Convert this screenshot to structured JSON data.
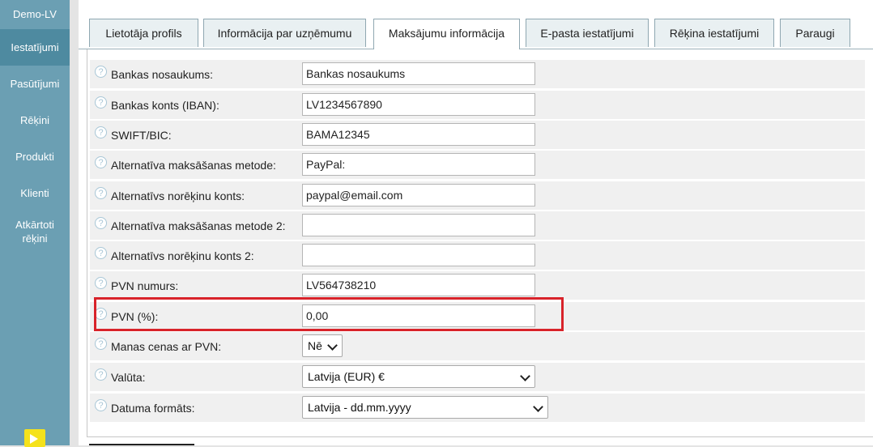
{
  "sidebar": {
    "brand": "Demo-LV",
    "items": [
      {
        "label": "Iestatījumi"
      },
      {
        "label": "Pasūtījumi"
      },
      {
        "label": "Rēķini"
      },
      {
        "label": "Produkti"
      },
      {
        "label": "Klienti"
      },
      {
        "label_line1": "Atkārtoti",
        "label_line2": "rēķini"
      }
    ]
  },
  "tabs": [
    {
      "label": "Lietotāja profils"
    },
    {
      "label": "Informācija par uzņēmumu"
    },
    {
      "label": "Maksājumu informācija"
    },
    {
      "label": "E-pasta iestatījumi"
    },
    {
      "label": "Rēķina iestatījumi"
    },
    {
      "label": "Paraugi"
    }
  ],
  "form": {
    "help_glyph": "?",
    "bank_name": {
      "label": "Bankas nosaukums:",
      "value": "Bankas nosaukums"
    },
    "bank_account": {
      "label": "Bankas konts (IBAN):",
      "value": "LV1234567890"
    },
    "swift": {
      "label": "SWIFT/BIC:",
      "value": "BAMA12345"
    },
    "alt_method": {
      "label": "Alternatīva maksāšanas metode:",
      "value": "PayPal:"
    },
    "alt_account": {
      "label": "Alternatīvs norēķinu konts:",
      "value": "paypal@email.com"
    },
    "alt_method2": {
      "label": "Alternatīva maksāšanas metode 2:",
      "value": ""
    },
    "alt_account2": {
      "label": "Alternatīvs norēķinu konts 2:",
      "value": ""
    },
    "vat_number": {
      "label": "PVN numurs:",
      "value": "LV564738210"
    },
    "vat_percent": {
      "label": "PVN (%):",
      "value": "0,00"
    },
    "prices_with_vat": {
      "label": "Manas cenas ar PVN:",
      "value": "Nē"
    },
    "currency": {
      "label": "Valūta:",
      "value": "Latvija (EUR) €"
    },
    "date_format": {
      "label": "Datuma formāts:",
      "value": "Latvija - dd.mm.yyyy"
    }
  },
  "colors": {
    "sidebar": "#6b9fb3",
    "highlight": "#d8232a",
    "logout": "#f5e21c"
  }
}
